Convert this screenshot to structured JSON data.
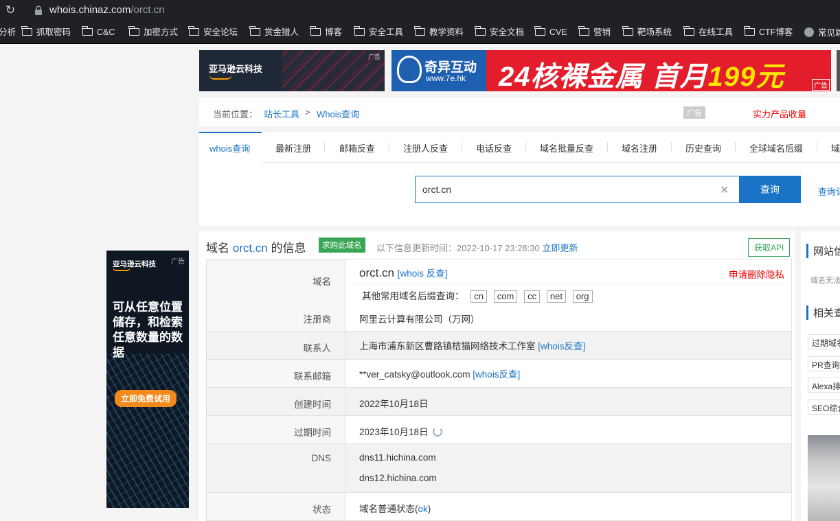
{
  "browser": {
    "url_host": "whois.chinaz.com",
    "url_path": "/orct.cn",
    "bookmarks": [
      "分析",
      "抓取密码",
      "C&C",
      "加密方式",
      "安全论坛",
      "赏金猎人",
      "博客",
      "安全工具",
      "教学资料",
      "安全文档",
      "CVE",
      "营销",
      "靶场系统",
      "在线工具",
      "CTF博客",
      "常见端"
    ]
  },
  "ads": {
    "aws_top": {
      "brand": "亚马逊云科技",
      "tag": "广告"
    },
    "seven_e": {
      "name": "奇异互动",
      "url": "www.7e.hk",
      "slogan_a": "24核裸金属 首月",
      "slogan_b": "199元",
      "tag": "广告"
    },
    "aws_side": {
      "brand": "亚马逊云科技",
      "tag": "广告",
      "headline": "可从任意位置储存，和检索任意数量的数据",
      "cta": "立即免费试用"
    }
  },
  "breadcrumb": {
    "label": "当前位置：",
    "link1": "站长工具",
    "sep": ">",
    "link2": "Whois查询",
    "ad_badge": "广告",
    "promo": "实力产品收量"
  },
  "tabs": [
    "whois查询",
    "最新注册",
    "邮箱反查",
    "注册人反查",
    "电话反查",
    "域名批量反查",
    "域名注册",
    "历史查询",
    "全球域名后缀",
    "域"
  ],
  "search": {
    "value": "orct.cn",
    "button": "查询",
    "extra": "查询记录"
  },
  "info": {
    "title_prefix": "域名",
    "domain": "orct.cn",
    "title_suffix": "的信息",
    "buy_badge": "求购此域名",
    "update_prefix": "以下信息更新时间：",
    "update_time": "2022-10-17 23:28:30",
    "update_link": "立即更新",
    "api_button": "获取API",
    "rows": {
      "domain_label": "域名",
      "domain_value": "orct.cn",
      "domain_link": "[whois 反查]",
      "privacy": "申请删除隐私",
      "suffix_label": "其他常用域名后缀查询：",
      "suffixes": [
        "cn",
        "com",
        "cc",
        "net",
        "org"
      ],
      "registrar_label": "注册商",
      "registrar_value": "阿里云计算有限公司（万网）",
      "contact_label": "联系人",
      "contact_value": "上海市浦东新区曹路镇桔猫网络技术工作室",
      "contact_link": "[whois反查]",
      "email_label": "联系邮箱",
      "email_value": "**ver_catsky@outlook.com",
      "email_link": "[whois反查]",
      "created_label": "创建时间",
      "created_value": "2022年10月18日",
      "expire_label": "过期时间",
      "expire_value": "2023年10月18日",
      "dns_label": "DNS",
      "dns1": "dns11.hichina.com",
      "dns2": "dns12.hichina.com",
      "status_label": "状态",
      "status_prefix": "域名普通状态(",
      "status_link": "ok",
      "status_suffix": ")"
    }
  },
  "right_col": {
    "head1": "网站信息",
    "sub1": "域名无法",
    "head2": "相关查询",
    "items": [
      "过期域名",
      "PR查询",
      "Alexa排名",
      "SEO综合"
    ]
  },
  "colors": {
    "accent": "#1a73c6",
    "green": "#3aa655",
    "red": "#e00000"
  }
}
